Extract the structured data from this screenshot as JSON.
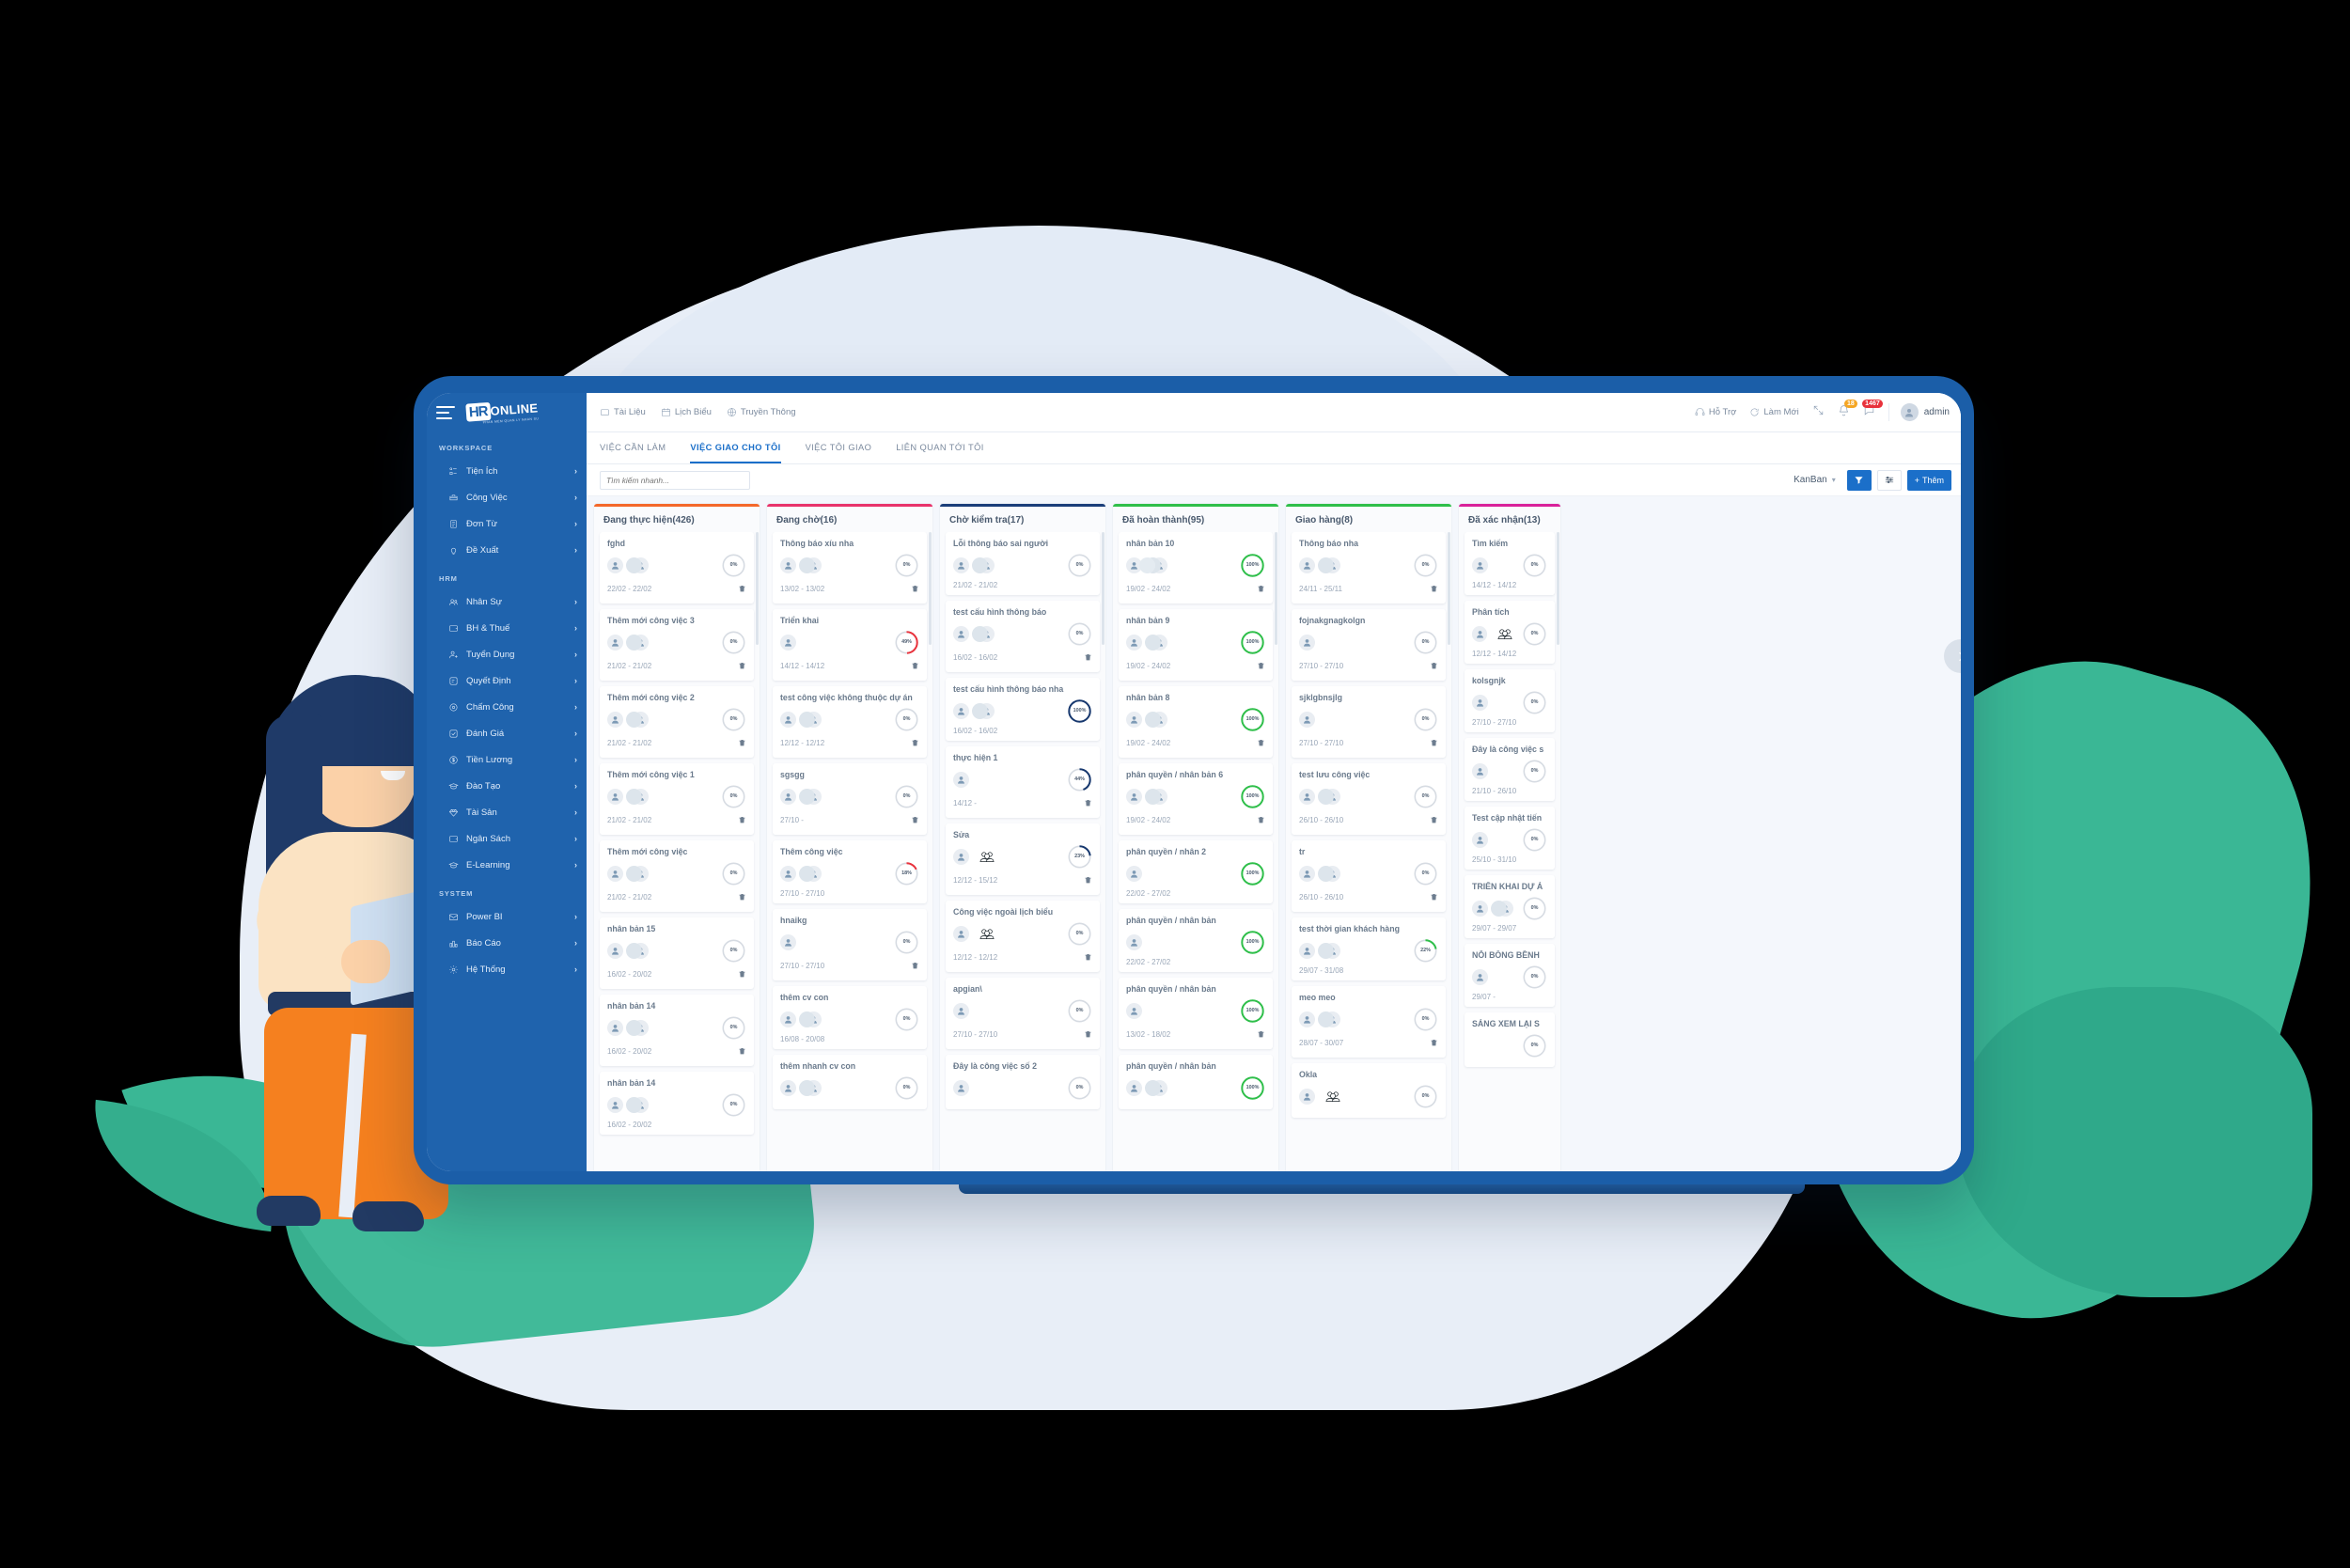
{
  "brand": {
    "logo_hr": "HR",
    "logo_online": "ONLINE",
    "logo_sub": "PHAN MEM QUAN LY NHAN SU"
  },
  "sidebar": {
    "sections": [
      {
        "title": "WORKSPACE",
        "items": [
          {
            "label": "Tiện Ích",
            "icon": "tiles-icon",
            "arrow": "›"
          },
          {
            "label": "Công Việc",
            "icon": "briefcase-icon",
            "arrow": "›"
          },
          {
            "label": "Đơn Từ",
            "icon": "document-icon",
            "arrow": "›"
          },
          {
            "label": "Đề Xuất",
            "icon": "lightbulb-icon",
            "arrow": "›"
          }
        ]
      },
      {
        "title": "HRM",
        "items": [
          {
            "label": "Nhân Sự",
            "icon": "people-icon",
            "arrow": "›"
          },
          {
            "label": "BH & Thuế",
            "icon": "wallet-icon",
            "arrow": "›"
          },
          {
            "label": "Tuyển Dụng",
            "icon": "user-plus-icon",
            "arrow": "›"
          },
          {
            "label": "Quyết Định",
            "icon": "note-edit-icon",
            "arrow": "›"
          },
          {
            "label": "Chấm Công",
            "icon": "location-pin-icon",
            "arrow": "›"
          },
          {
            "label": "Đánh Giá",
            "icon": "checkbox-icon",
            "arrow": "›"
          },
          {
            "label": "Tiền Lương",
            "icon": "dollar-circle-icon",
            "arrow": "›"
          },
          {
            "label": "Đào Tạo",
            "icon": "graduation-cap-icon",
            "arrow": "›"
          },
          {
            "label": "Tài Sản",
            "icon": "diamond-icon",
            "arrow": "›"
          },
          {
            "label": "Ngân Sách",
            "icon": "wallet-icon",
            "arrow": "›"
          },
          {
            "label": "E-Learning",
            "icon": "graduation-cap-icon",
            "arrow": "›"
          }
        ]
      },
      {
        "title": "SYSTEM",
        "items": [
          {
            "label": "Power BI",
            "icon": "envelope-icon",
            "arrow": "›"
          },
          {
            "label": "Báo Cáo",
            "icon": "bar-chart-icon",
            "arrow": "›"
          },
          {
            "label": "Hệ Thống",
            "icon": "gear-icon",
            "arrow": "›"
          }
        ]
      }
    ]
  },
  "topbar": {
    "links": [
      {
        "label": "Tài Liệu",
        "icon": "folder-icon"
      },
      {
        "label": "Lịch Biểu",
        "icon": "calendar-icon"
      },
      {
        "label": "Truyền Thông",
        "icon": "globe-icon"
      }
    ],
    "support_label": "Hỗ Trợ",
    "refresh_label": "Làm Mới",
    "notif_badge": "18",
    "message_badge": "1467",
    "user_name": "admin"
  },
  "tabs": [
    {
      "label": "VIỆC CẦN LÀM",
      "active": false
    },
    {
      "label": "VIỆC GIAO CHO TÔI",
      "active": true
    },
    {
      "label": "VIỆC TÔI GIAO",
      "active": false
    },
    {
      "label": "LIÊN QUAN TỚI TÔI",
      "active": false
    }
  ],
  "toolbar": {
    "search_placeholder": "Tìm kiếm nhanh...",
    "search_value": "",
    "view_mode": "KanBan",
    "chevron": "⌄",
    "filter_icon": "filter-icon",
    "settings_icon": "sliders-icon",
    "add_label": "Thêm",
    "add_plus": "+"
  },
  "colors": {
    "strip_orange": "#f4682a",
    "strip_pink": "#e8336b",
    "strip_navy": "#1b3f7a",
    "strip_green": "#2fbf4a",
    "strip_green2": "#2fbf4a",
    "strip_magenta": "#d9219a",
    "ring_grey": "#d6dbe2",
    "ring_red": "#e8323c",
    "ring_navy": "#17386e",
    "ring_green": "#2fbf4a",
    "primary_blue": "#1b6fc9",
    "sidebar_blue": "#1f63ad"
  },
  "board": {
    "columns": [
      {
        "title": "Đang thực hiện(426)",
        "strip": "#f4682a",
        "cards": [
          {
            "title": "fghd",
            "avatars": 2,
            "group": false,
            "dates": "22/02 - 22/02",
            "pct": 0,
            "ring": "grey",
            "trash": true
          },
          {
            "title": "Thêm mới công việc 3",
            "avatars": 2,
            "group": false,
            "dates": "21/02 - 21/02",
            "pct": 0,
            "ring": "grey",
            "trash": true
          },
          {
            "title": "Thêm mới công việc 2",
            "avatars": 2,
            "group": false,
            "dates": "21/02 - 21/02",
            "pct": 0,
            "ring": "grey",
            "trash": true
          },
          {
            "title": "Thêm mới công việc 1",
            "avatars": 2,
            "group": false,
            "dates": "21/02 - 21/02",
            "pct": 0,
            "ring": "grey",
            "trash": true
          },
          {
            "title": "Thêm mới công việc",
            "avatars": 2,
            "group": false,
            "dates": "21/02 - 21/02",
            "pct": 0,
            "ring": "grey",
            "trash": true
          },
          {
            "title": "nhân bản 15",
            "avatars": 2,
            "stack": true,
            "group": false,
            "dates": "16/02 - 20/02",
            "pct": 0,
            "ring": "grey",
            "trash": true
          },
          {
            "title": "nhân bản 14",
            "avatars": 2,
            "stack": true,
            "group": false,
            "dates": "16/02 - 20/02",
            "pct": 0,
            "ring": "grey",
            "trash": true
          },
          {
            "title": "nhân bản 14",
            "avatars": 2,
            "stack": true,
            "group": false,
            "dates": "16/02 - 20/02",
            "pct": 0,
            "ring": "grey",
            "trash": false
          }
        ]
      },
      {
        "title": "Đang chờ(16)",
        "strip": "#e8336b",
        "cards": [
          {
            "title": "Thông báo xíu nha",
            "avatars": 2,
            "group": false,
            "dates": "13/02 - 13/02",
            "pct": 0,
            "ring": "grey",
            "trash": true
          },
          {
            "title": "Triển khai",
            "avatars": 1,
            "group": false,
            "dates": "14/12 - 14/12",
            "pct": 49,
            "ring": "red",
            "trash": true
          },
          {
            "title": "test công việc không thuộc dự án",
            "avatars": 2,
            "group": false,
            "dates": "12/12 - 12/12",
            "pct": 0,
            "ring": "grey",
            "trash": true
          },
          {
            "title": "sgsgg",
            "avatars": 2,
            "group": false,
            "dates": "27/10 -",
            "pct": 0,
            "ring": "grey",
            "trash": true
          },
          {
            "title": "Thêm công việc",
            "avatars": 2,
            "group": false,
            "dates": "27/10 - 27/10",
            "pct": 18,
            "ring": "red",
            "trash": false
          },
          {
            "title": "hnaikg",
            "avatars": 1,
            "group": false,
            "dates": "27/10 - 27/10",
            "pct": 0,
            "ring": "grey",
            "trash": true
          },
          {
            "title": "thêm cv con",
            "avatars": 2,
            "group": false,
            "dates": "16/08 - 20/08",
            "pct": 0,
            "ring": "grey",
            "trash": false
          },
          {
            "title": "thêm nhanh cv con",
            "avatars": 2,
            "group": false,
            "dates": "",
            "pct": 0,
            "ring": "grey",
            "trash": false
          }
        ]
      },
      {
        "title": "Chờ kiểm tra(17)",
        "strip": "#1b3f7a",
        "cards": [
          {
            "title": "Lỗi thông báo sai người",
            "avatars": 2,
            "stack": true,
            "group": false,
            "dates": "21/02 - 21/02",
            "pct": 0,
            "ring": "grey",
            "trash": false
          },
          {
            "title": "test cấu hình thông báo",
            "avatars": 2,
            "group": false,
            "dates": "16/02 - 16/02",
            "pct": 0,
            "ring": "grey",
            "trash": true
          },
          {
            "title": "test cấu hình thông báo nha",
            "avatars": 2,
            "group": false,
            "dates": "16/02 - 16/02",
            "pct": 100,
            "ring": "navy",
            "trash": false
          },
          {
            "title": "thực hiện 1",
            "avatars": 1,
            "group": false,
            "dates": "14/12 -",
            "pct": 44,
            "ring": "navy",
            "trash": true
          },
          {
            "title": "Sửa",
            "avatars": 1,
            "group": true,
            "dates": "12/12 - 15/12",
            "pct": 23,
            "ring": "navy",
            "trash": true
          },
          {
            "title": "Công việc ngoài lịch biểu",
            "avatars": 1,
            "group": true,
            "dates": "12/12 - 12/12",
            "pct": 0,
            "ring": "grey",
            "trash": true
          },
          {
            "title": "apgian\\",
            "avatars": 1,
            "group": false,
            "dates": "27/10 - 27/10",
            "pct": 0,
            "ring": "grey",
            "trash": true
          },
          {
            "title": "Đây là công việc số 2",
            "avatars": 1,
            "group": false,
            "dates": "",
            "pct": 0,
            "ring": "grey",
            "trash": false
          }
        ]
      },
      {
        "title": "Đã hoàn thành(95)",
        "strip": "#2fbf4a",
        "cards": [
          {
            "title": "nhân bản 10",
            "avatars": 2,
            "stack": true,
            "triple": true,
            "group": false,
            "dates": "19/02 - 24/02",
            "pct": 100,
            "ring": "green",
            "trash": true
          },
          {
            "title": "nhân bản 9",
            "avatars": 2,
            "stack": true,
            "group": false,
            "dates": "19/02 - 24/02",
            "pct": 100,
            "ring": "green",
            "trash": true
          },
          {
            "title": "nhân bản 8",
            "avatars": 2,
            "group": false,
            "dates": "19/02 - 24/02",
            "pct": 100,
            "ring": "green",
            "trash": true
          },
          {
            "title": "phân quyền / nhân bản 6",
            "avatars": 2,
            "group": false,
            "dates": "19/02 - 24/02",
            "pct": 100,
            "ring": "green",
            "trash": true
          },
          {
            "title": "phân quyền / nhân 2",
            "avatars": 1,
            "group": false,
            "dates": "22/02 - 27/02",
            "pct": 100,
            "ring": "green",
            "trash": false
          },
          {
            "title": "phân quyền / nhân bản",
            "avatars": 1,
            "group": false,
            "dates": "22/02 - 27/02",
            "pct": 100,
            "ring": "green",
            "trash": false
          },
          {
            "title": "phân quyền / nhân bản",
            "avatars": 1,
            "group": false,
            "dates": "13/02 - 18/02",
            "pct": 100,
            "ring": "green",
            "trash": true
          },
          {
            "title": "phân quyền / nhân bản",
            "avatars": 2,
            "group": false,
            "dates": "",
            "pct": 100,
            "ring": "green",
            "trash": false
          }
        ]
      },
      {
        "title": "Giao hàng(8)",
        "strip": "#2fbf4a",
        "cards": [
          {
            "title": "Thông báo nha",
            "avatars": 2,
            "stack": true,
            "group": false,
            "dates": "24/11 - 25/11",
            "pct": 0,
            "ring": "grey",
            "trash": true
          },
          {
            "title": "fojnakgnagkolgn",
            "avatars": 1,
            "group": false,
            "dates": "27/10 - 27/10",
            "pct": 0,
            "ring": "grey",
            "trash": true
          },
          {
            "title": "sjklgbnsjlg",
            "avatars": 1,
            "group": false,
            "dates": "27/10 - 27/10",
            "pct": 0,
            "ring": "grey",
            "trash": true
          },
          {
            "title": "test lưu công việc",
            "avatars": 2,
            "group": false,
            "dates": "26/10 - 26/10",
            "pct": 0,
            "ring": "grey",
            "trash": true
          },
          {
            "title": "tr",
            "avatars": 2,
            "group": false,
            "dates": "26/10 - 26/10",
            "pct": 0,
            "ring": "grey",
            "trash": true
          },
          {
            "title": "test thời gian khách hàng",
            "avatars": 2,
            "group": false,
            "dates": "29/07 - 31/08",
            "pct": 22,
            "ring": "green",
            "trash": false
          },
          {
            "title": "meo meo",
            "avatars": 2,
            "group": false,
            "dates": "28/07 - 30/07",
            "pct": 0,
            "ring": "grey",
            "trash": true
          },
          {
            "title": "Okla",
            "avatars": 1,
            "group": true,
            "dates": "",
            "pct": 0,
            "ring": "grey",
            "trash": false
          }
        ]
      },
      {
        "title": "Đã xác nhận(13)",
        "strip": "#d9219a",
        "partial": true,
        "cards": [
          {
            "title": "Tìm kiếm",
            "avatars": 1,
            "group": false,
            "dates": "14/12 - 14/12",
            "pct": 0,
            "ring": "grey",
            "trash": false
          },
          {
            "title": "Phân tích",
            "avatars": 1,
            "group": true,
            "dates": "12/12 - 14/12",
            "pct": 0,
            "ring": "grey",
            "trash": false
          },
          {
            "title": "kolsgnjk",
            "avatars": 1,
            "group": false,
            "dates": "27/10 - 27/10",
            "pct": 0,
            "ring": "grey",
            "trash": false
          },
          {
            "title": "Đây là công việc s",
            "avatars": 1,
            "group": false,
            "dates": "21/10 - 26/10",
            "pct": 0,
            "ring": "grey",
            "trash": false
          },
          {
            "title": "Test cập nhật tiến",
            "avatars": 1,
            "group": false,
            "dates": "25/10 - 31/10",
            "pct": 0,
            "ring": "grey",
            "trash": false
          },
          {
            "title": "TRIỂN KHAI DỰ Á",
            "avatars": 2,
            "group": false,
            "dates": "29/07 - 29/07",
            "pct": 0,
            "ring": "grey",
            "trash": false
          },
          {
            "title": "NỖI BỒNG BỀNH",
            "avatars": 1,
            "group": false,
            "dates": "29/07 -",
            "pct": 0,
            "ring": "grey",
            "trash": false
          },
          {
            "title": "SÁNG XEM LẠI S",
            "avatars": 0,
            "group": false,
            "dates": "",
            "pct": 0,
            "ring": "grey",
            "trash": false
          }
        ]
      }
    ],
    "next_arrow_icon": "chevron-right-icon"
  }
}
